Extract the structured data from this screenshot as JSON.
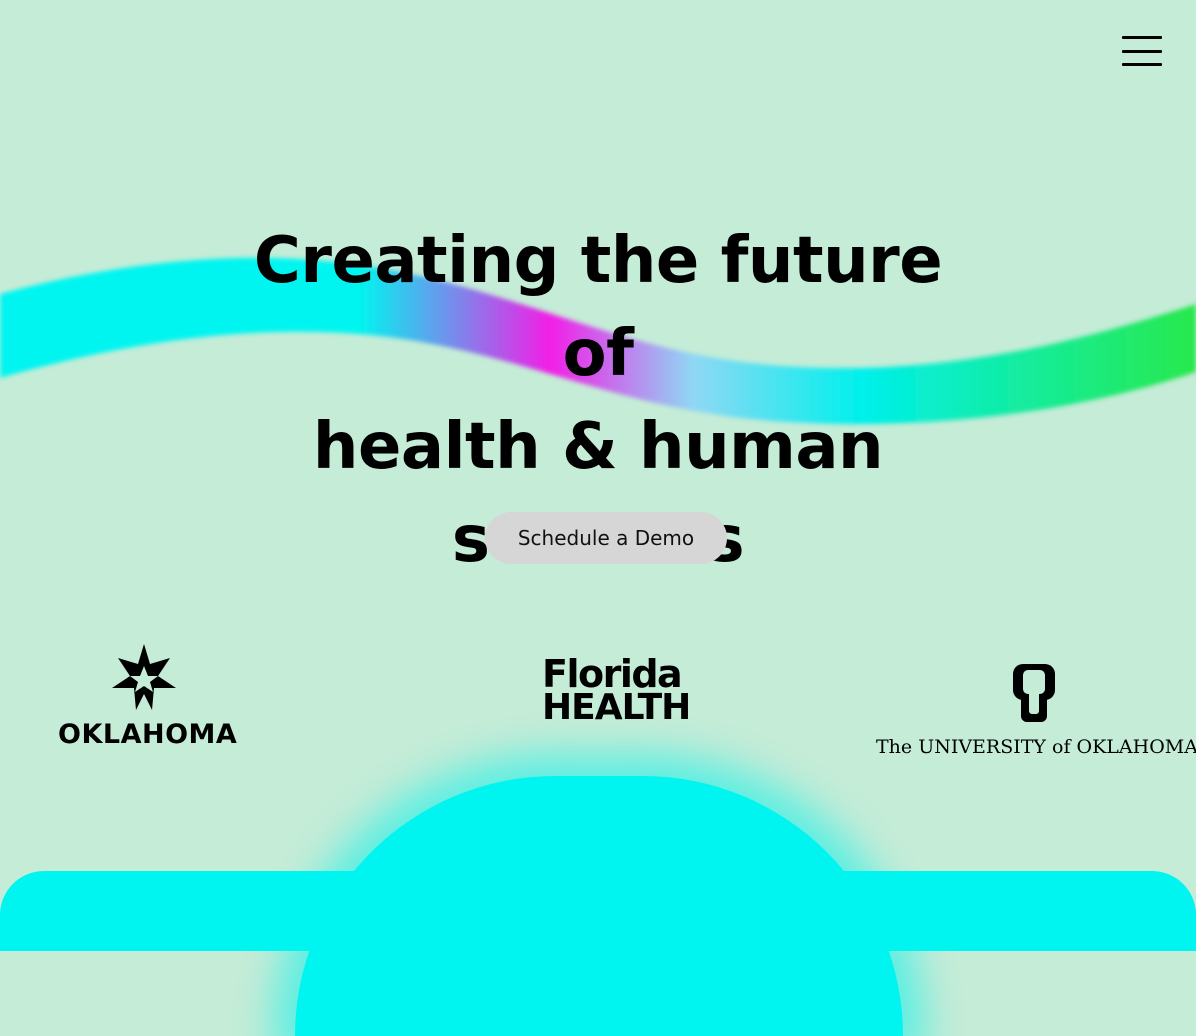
{
  "colors": {
    "background": "#c5ecd7",
    "ribbon_cyan": "#00f5f0",
    "ribbon_magenta": "#f11fe6",
    "ribbon_green": "#20e85a",
    "cta_background": "#d6d6d6"
  },
  "header": {
    "menu_icon": "hamburger-menu-icon"
  },
  "hero": {
    "title_lines": [
      "Creating the future of",
      "health & human",
      "services"
    ],
    "cta_label": "Schedule a Demo"
  },
  "logos": {
    "oklahoma": {
      "icon": "oklahoma-star-icon",
      "text": "OKLAHOMA"
    },
    "florida_health": {
      "line1": "Florida",
      "line2": "HEALTH"
    },
    "university_of_oklahoma": {
      "icon": "ou-monogram-icon",
      "text": "The UNIVERSITY of OKLAHOMA"
    }
  }
}
